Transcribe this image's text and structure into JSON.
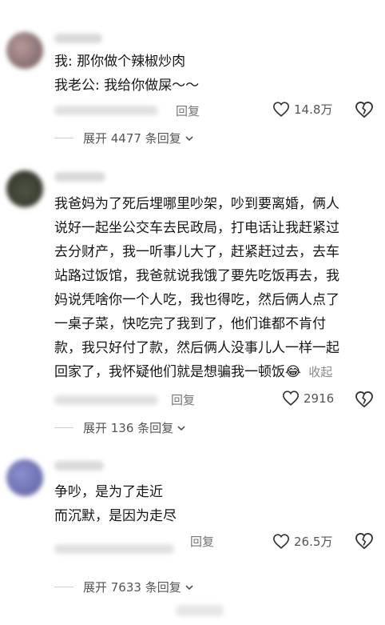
{
  "comments": [
    {
      "lines": [
        "我: 那你做个辣椒炒肉",
        "我老公: 我给你做屎～～"
      ],
      "reply_label": "回复",
      "likes": "14.8万",
      "expand_label": "展开 4477 条回复"
    },
    {
      "lines": [
        "我爸妈为了死后埋哪里吵架，吵到要离婚，俩人",
        "说好一起坐公交车去民政局，打电话让我赶紧过",
        "去分财产，我一听事儿大了，赶紧赶过去，去车",
        "站路过饭馆，我爸就说我饿了要先吃饭再去，我",
        "妈说凭啥你一个人吃，我也得吃，然后俩人点了",
        "一桌子菜，快吃完了我到了，他们谁都不肯付",
        "款，我只好付了款，然后俩人没事儿人一样一起",
        "回家了，我怀疑他们就是想骗我一顿饭"
      ],
      "emoji": "😂",
      "collapse_label": "收起",
      "reply_label": "回复",
      "likes": "2916",
      "expand_label": "展开 136 条回复"
    },
    {
      "lines": [
        "争吵，是为了走近",
        "而沉默，是因为走尽"
      ],
      "reply_label": "回复",
      "likes": "26.5万",
      "expand_label": "展开 7633 条回复"
    }
  ],
  "icons": {
    "like": "heart-outline-icon",
    "dislike": "broken-heart-icon",
    "expand": "chevron-down-icon"
  }
}
